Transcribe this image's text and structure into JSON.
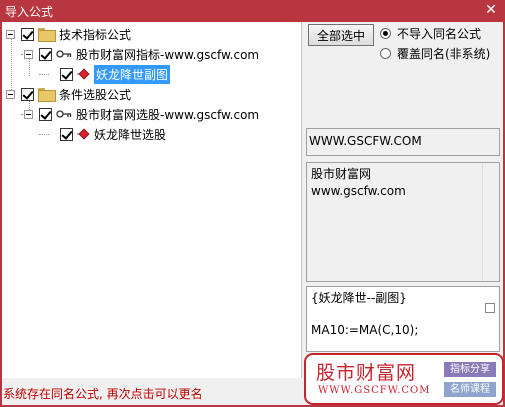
{
  "window": {
    "title": "导入公式",
    "close_glyph": "✕"
  },
  "tree": {
    "groups": [
      {
        "label": "技术指标公式",
        "checked": true,
        "children": [
          {
            "label": "股市财富网指标-www.gscfw.com",
            "checked": true,
            "children": [
              {
                "label": "妖龙降世副图",
                "checked": true,
                "selected": true
              }
            ]
          }
        ]
      },
      {
        "label": "条件选股公式",
        "checked": true,
        "children": [
          {
            "label": "股市财富网选股-www.gscfw.com",
            "checked": true,
            "children": [
              {
                "label": "妖龙降世选股",
                "checked": true,
                "selected": false
              }
            ]
          }
        ]
      }
    ]
  },
  "options": {
    "select_all_label": "全部选中",
    "radio_skip_label": "不导入同名公式",
    "radio_overwrite_label": "覆盖同名(非系统)",
    "selected": "skip"
  },
  "info": {
    "url_text": "WWW.GSCFW.COM",
    "description_line1": "股市财富网",
    "description_line2": "www.gscfw.com",
    "formula_line1": "{妖龙降世--副图}",
    "formula_line2": "MA10:=MA(C,10);"
  },
  "watermark": {
    "cn": "股市财富网",
    "en": "WWW.GSCFW.COM",
    "tag1": "指标分享",
    "tag2": "名师课程"
  },
  "status": {
    "message": "系统存在同名公式, 再次点击可以更名"
  },
  "colors": {
    "title_bar": "#b8363f",
    "selection": "#3399ff",
    "status_text": "#c00000",
    "watermark": "#c8242e"
  }
}
